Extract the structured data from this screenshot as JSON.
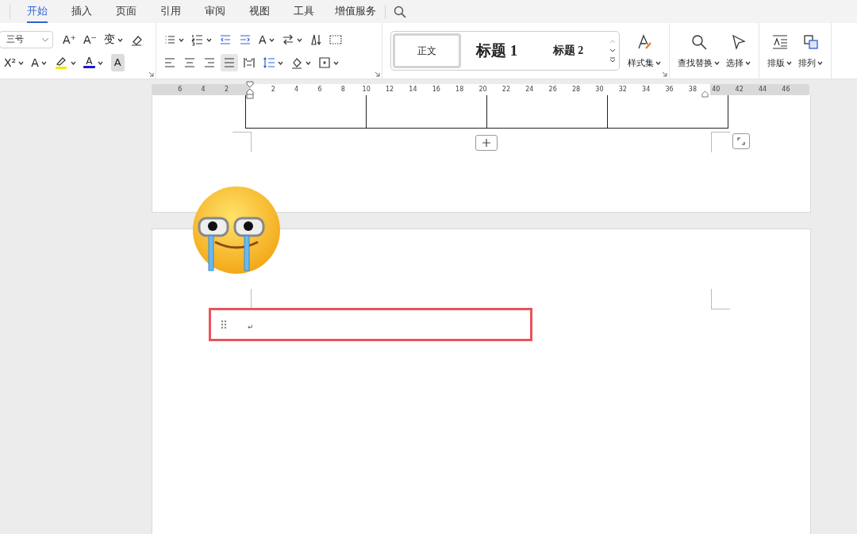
{
  "tabs": [
    {
      "label": "开始",
      "selected": true
    },
    {
      "label": "插入",
      "selected": false
    },
    {
      "label": "页面",
      "selected": false
    },
    {
      "label": "引用",
      "selected": false
    },
    {
      "label": "审阅",
      "selected": false
    },
    {
      "label": "视图",
      "selected": false
    },
    {
      "label": "工具",
      "selected": false
    },
    {
      "label": "增值服务",
      "selected": false
    }
  ],
  "font_group": {
    "font_size": "三号",
    "row1": [
      {
        "kind": "glyph",
        "glyph": "A⁺",
        "caret": false
      },
      {
        "kind": "glyph",
        "glyph": "A⁻",
        "caret": false
      },
      {
        "kind": "glyph",
        "glyph": "变",
        "caret": true
      },
      {
        "kind": "eraser",
        "caret": false
      }
    ],
    "row2": [
      {
        "kind": "glyph",
        "glyph": "X²",
        "caret": true
      },
      {
        "kind": "glyph",
        "glyph": "A",
        "caret": true
      },
      {
        "kind": "highlight",
        "color": "#f2e600",
        "caret": true
      },
      {
        "kind": "glyph-bar",
        "glyph": "A",
        "color": "#1a1ad0",
        "caret": true
      },
      {
        "kind": "shaded",
        "glyph": "A",
        "caret": false
      }
    ]
  },
  "paragraph_group": {
    "row1": [
      {
        "kind": "bullets",
        "caret": true
      },
      {
        "kind": "numbering",
        "caret": true
      },
      {
        "kind": "outdent",
        "caret": false
      },
      {
        "kind": "indent",
        "caret": false
      },
      {
        "kind": "glyph",
        "glyph": "A",
        "caret": true
      },
      {
        "kind": "bidi",
        "caret": true
      },
      {
        "kind": "sort",
        "caret": false
      },
      {
        "kind": "dotted-border",
        "caret": false
      }
    ],
    "row2": [
      {
        "kind": "align-left",
        "caret": false,
        "selected": false
      },
      {
        "kind": "align-center",
        "caret": false,
        "selected": false
      },
      {
        "kind": "align-right",
        "caret": false,
        "selected": false
      },
      {
        "kind": "justify",
        "caret": false,
        "selected": true
      },
      {
        "kind": "distributed",
        "caret": false,
        "selected": false
      },
      {
        "kind": "line-spacing",
        "caret": true,
        "selected": false
      },
      {
        "kind": "fill",
        "caret": true,
        "selected": false
      },
      {
        "kind": "borders",
        "caret": true,
        "selected": false
      }
    ]
  },
  "styles": [
    {
      "label": "正文",
      "selected": true
    },
    {
      "label": "标题 1",
      "selected": false
    },
    {
      "label": "标题 2",
      "selected": false
    }
  ],
  "big_groups": [
    [
      {
        "kind": "styles",
        "label": "样式集"
      }
    ],
    [
      {
        "kind": "find",
        "label": "查找替换"
      },
      {
        "kind": "select",
        "label": "选择"
      }
    ],
    [
      {
        "kind": "layout",
        "label": "排版"
      },
      {
        "kind": "arrange",
        "label": "排列"
      }
    ]
  ],
  "ruler": {
    "left_ticks": [
      "6",
      "4",
      "2"
    ],
    "right_ticks": [
      "2",
      "4",
      "6",
      "8",
      "10",
      "12",
      "14",
      "16",
      "18",
      "20",
      "22",
      "24",
      "26",
      "28",
      "30",
      "32",
      "34",
      "36",
      "38",
      "40",
      "42",
      "44",
      "46"
    ]
  },
  "document": {
    "paragraph_mark": "↵"
  }
}
